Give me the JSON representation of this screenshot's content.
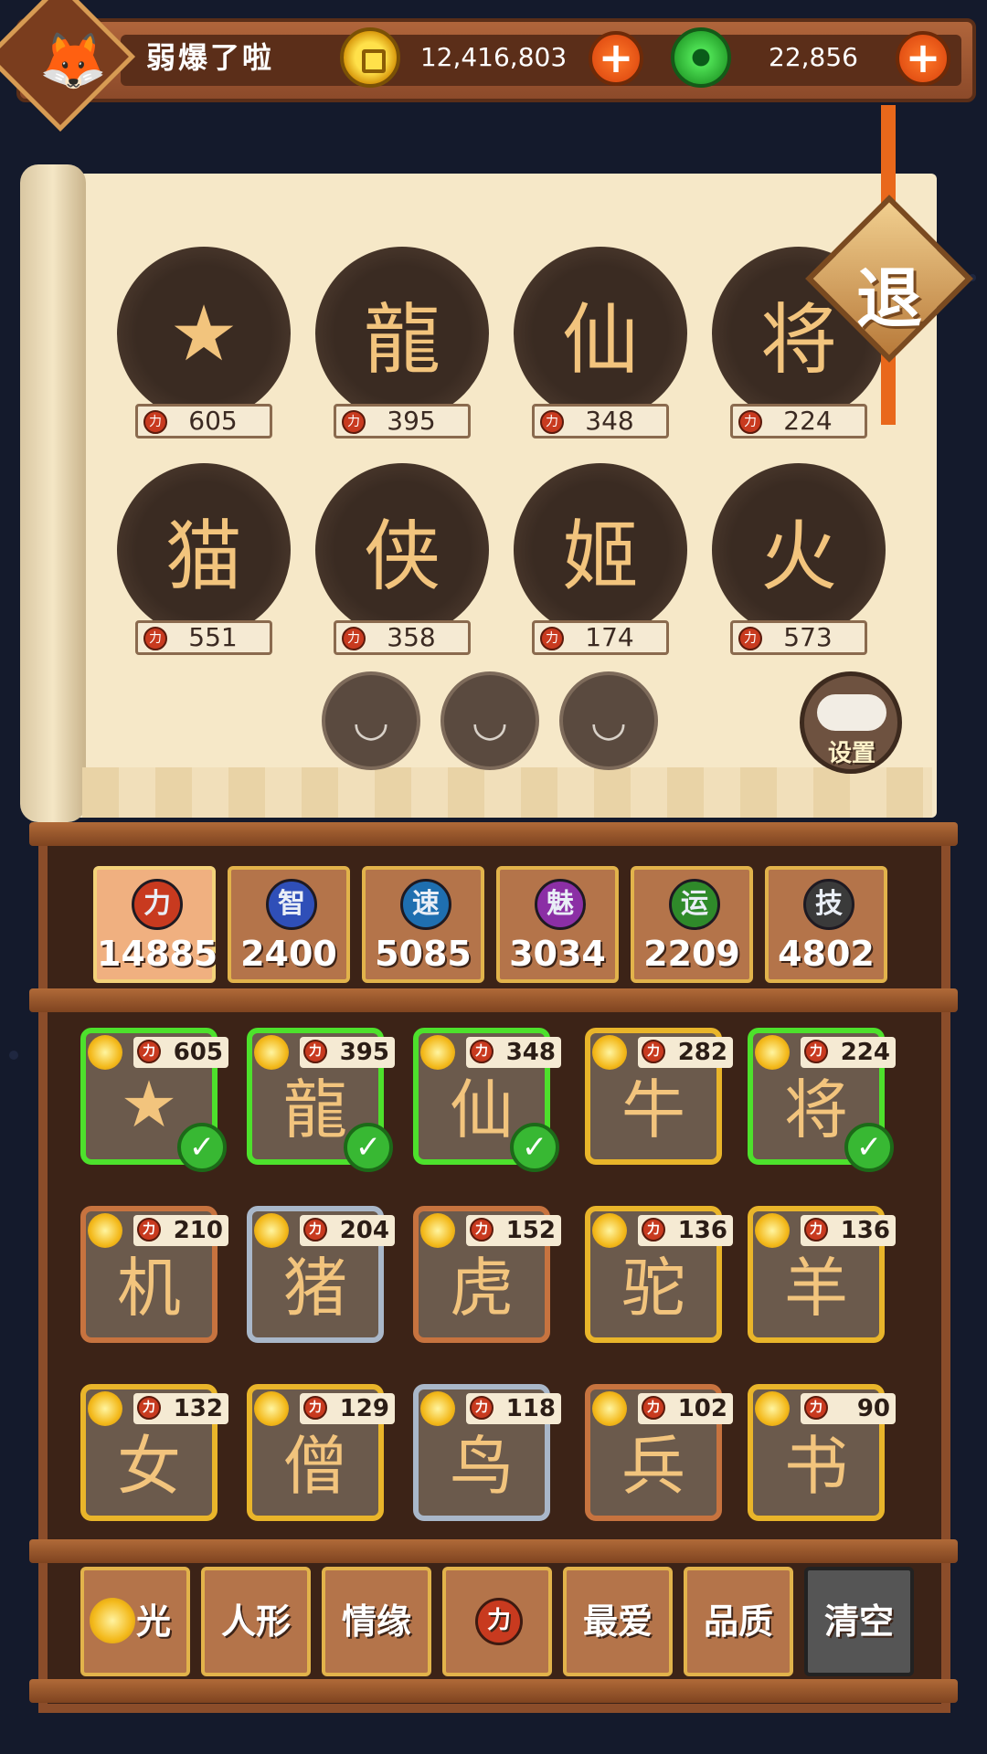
{
  "player": {
    "name": "弱爆了啦",
    "avatar_icon": "fox-mask-icon"
  },
  "currencies": {
    "gold": "12,416,803",
    "jade": "22,856"
  },
  "exit_label": "退",
  "settings_label": "设置",
  "featured_heroes": [
    {
      "power": "605",
      "icon": "★"
    },
    {
      "power": "395",
      "icon": "龍"
    },
    {
      "power": "348",
      "icon": "仙"
    },
    {
      "power": "224",
      "icon": "将"
    },
    {
      "power": "551",
      "icon": "猫"
    },
    {
      "power": "358",
      "icon": "侠"
    },
    {
      "power": "174",
      "icon": "姬"
    },
    {
      "power": "573",
      "icon": "火"
    }
  ],
  "stat_tabs": [
    {
      "glyph": "力",
      "value": "14885",
      "color": "#c83a1f",
      "active": true
    },
    {
      "glyph": "智",
      "value": "2400",
      "color": "#2f4fb8",
      "active": false
    },
    {
      "glyph": "速",
      "value": "5085",
      "color": "#1f6fb0",
      "active": false
    },
    {
      "glyph": "魅",
      "value": "3034",
      "color": "#8b2fa5",
      "active": false
    },
    {
      "glyph": "运",
      "value": "2209",
      "color": "#2f8a2a",
      "active": false
    },
    {
      "glyph": "技",
      "value": "4802",
      "color": "#3a3a3a",
      "active": false
    }
  ],
  "roster": [
    {
      "power": "605",
      "frame": "sel",
      "checked": true,
      "icon": "★"
    },
    {
      "power": "395",
      "frame": "sel",
      "checked": true,
      "icon": "龍"
    },
    {
      "power": "348",
      "frame": "sel",
      "checked": true,
      "icon": "仙"
    },
    {
      "power": "282",
      "frame": "gold",
      "checked": false,
      "icon": "牛"
    },
    {
      "power": "224",
      "frame": "sel",
      "checked": true,
      "icon": "将"
    },
    {
      "power": "210",
      "frame": "bronze",
      "checked": false,
      "icon": "机"
    },
    {
      "power": "204",
      "frame": "blue",
      "checked": false,
      "icon": "猪"
    },
    {
      "power": "152",
      "frame": "bronze",
      "checked": false,
      "icon": "虎"
    },
    {
      "power": "136",
      "frame": "gold",
      "checked": false,
      "icon": "驼"
    },
    {
      "power": "136",
      "frame": "gold",
      "checked": false,
      "icon": "羊"
    },
    {
      "power": "132",
      "frame": "gold",
      "checked": false,
      "icon": "女"
    },
    {
      "power": "129",
      "frame": "gold",
      "checked": false,
      "icon": "僧"
    },
    {
      "power": "118",
      "frame": "blue",
      "checked": false,
      "icon": "鸟"
    },
    {
      "power": "102",
      "frame": "bronze",
      "checked": false,
      "icon": "兵"
    },
    {
      "power": "90",
      "frame": "gold",
      "checked": false,
      "icon": "书"
    }
  ],
  "filters": [
    {
      "label": "光"
    },
    {
      "label": "人形"
    },
    {
      "label": "情缘"
    },
    {
      "label": ""
    },
    {
      "label": "最爱"
    },
    {
      "label": "品质"
    },
    {
      "label": "清空"
    }
  ]
}
